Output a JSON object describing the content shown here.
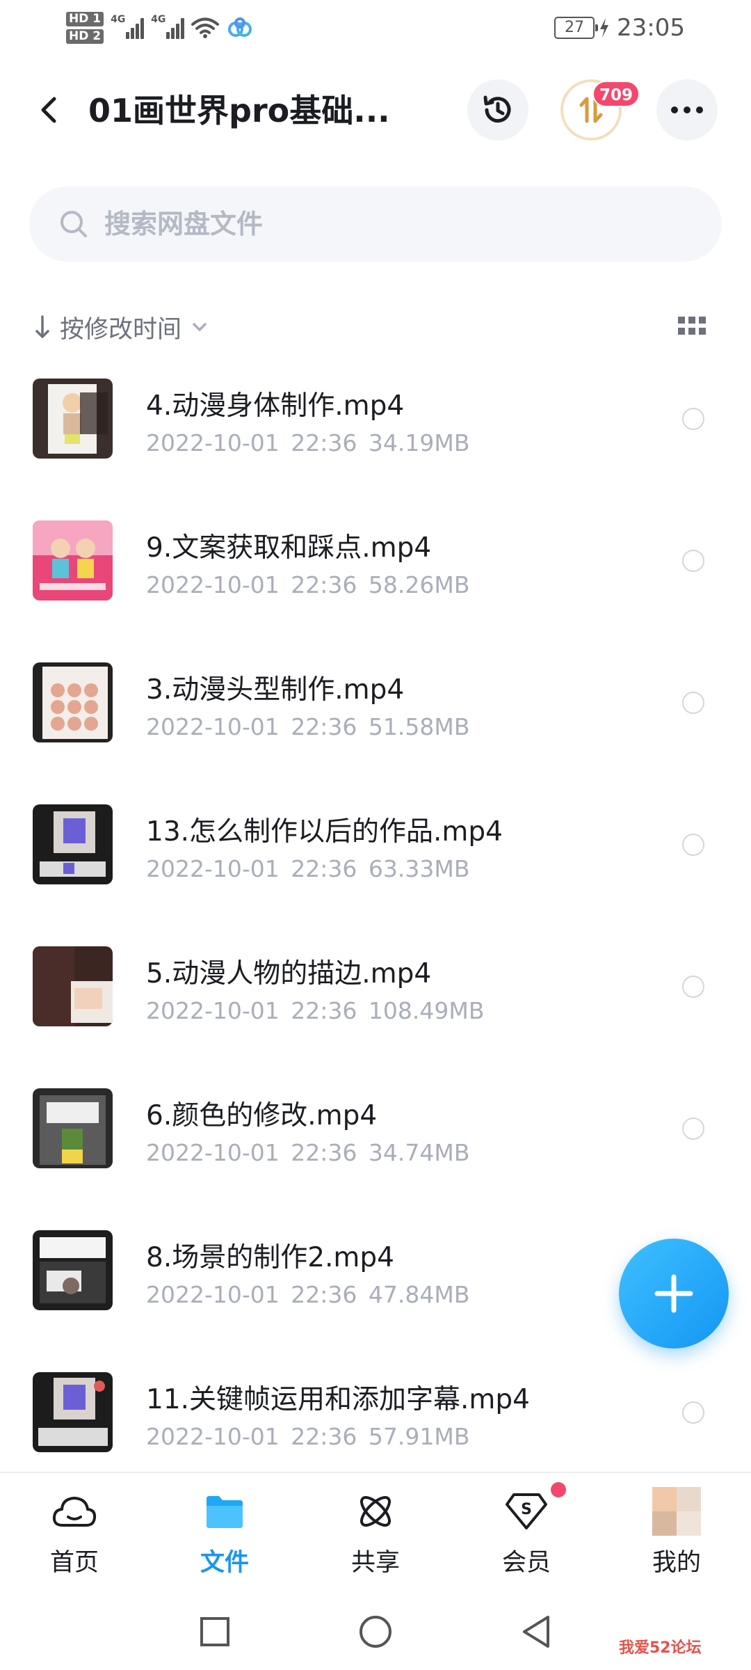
{
  "status_bar": {
    "hd1": "HD 1",
    "hd2": "HD 2",
    "net1": "4G",
    "net2": "4G",
    "battery": "27",
    "time": "23:05"
  },
  "header": {
    "title": "01画世界pro基础...",
    "transfer_badge": "709"
  },
  "search": {
    "placeholder": "搜索网盘文件"
  },
  "sort": {
    "label": "按修改时间"
  },
  "files": [
    {
      "name": "4.动漫身体制作.mp4",
      "date": "2022-10-01",
      "time": "22:36",
      "size": "34.19MB"
    },
    {
      "name": "9.文案获取和踩点.mp4",
      "date": "2022-10-01",
      "time": "22:36",
      "size": "58.26MB"
    },
    {
      "name": "3.动漫头型制作.mp4",
      "date": "2022-10-01",
      "time": "22:36",
      "size": "51.58MB"
    },
    {
      "name": "13.怎么制作以后的作品.mp4",
      "date": "2022-10-01",
      "time": "22:36",
      "size": "63.33MB"
    },
    {
      "name": "5.动漫人物的描边.mp4",
      "date": "2022-10-01",
      "time": "22:36",
      "size": "108.49MB"
    },
    {
      "name": "6.颜色的修改.mp4",
      "date": "2022-10-01",
      "time": "22:36",
      "size": "34.74MB"
    },
    {
      "name": "8.场景的制作2.mp4",
      "date": "2022-10-01",
      "time": "22:36",
      "size": "47.84MB"
    },
    {
      "name": "11.关键帧运用和添加字幕.mp4",
      "date": "2022-10-01",
      "time": "22:36",
      "size": "57.91MB"
    }
  ],
  "bottom_nav": [
    {
      "label": "首页",
      "icon": "cloud-icon"
    },
    {
      "label": "文件",
      "icon": "folder-icon",
      "active": true
    },
    {
      "label": "共享",
      "icon": "share-atom-icon"
    },
    {
      "label": "会员",
      "icon": "vip-diamond-icon"
    },
    {
      "label": "我的",
      "icon": "avatar"
    }
  ],
  "colors": {
    "accent": "#1896f4",
    "badge": "#f4476b",
    "meta_text": "#a9aeb8"
  },
  "watermark": "我爱52论坛"
}
